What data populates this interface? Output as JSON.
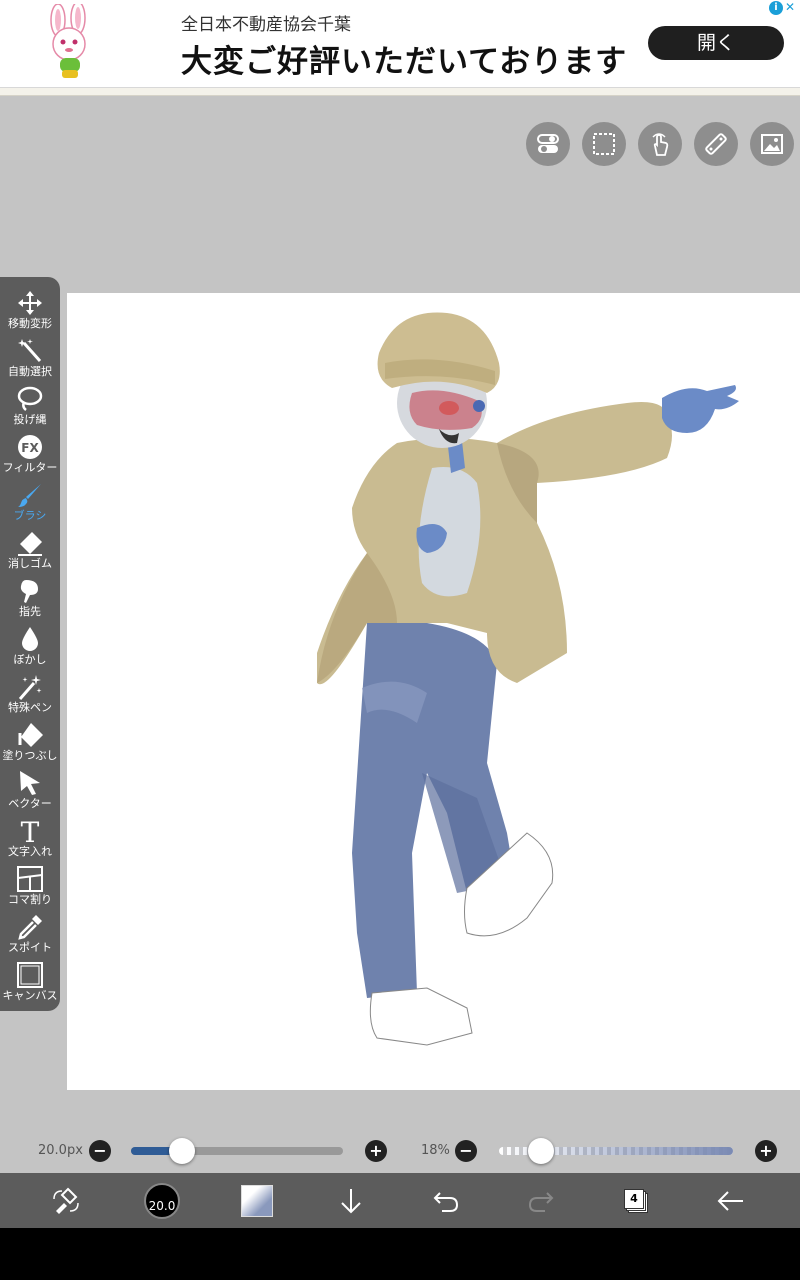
{
  "ad": {
    "org": "全日本不動産協会千葉",
    "headline": "大変ご好評いただいております",
    "button_label": "開く",
    "info_glyph": "i",
    "close_glyph": "✕"
  },
  "top_buttons": [
    "toggle-icon",
    "selection-icon",
    "touch-icon",
    "ruler-icon",
    "image-icon"
  ],
  "toolbar": {
    "items": [
      {
        "label": "移動変形",
        "icon": "move-icon"
      },
      {
        "label": "自動選択",
        "icon": "magic-wand-icon"
      },
      {
        "label": "投げ縄",
        "icon": "lasso-icon"
      },
      {
        "label": "フィルター",
        "icon": "fx-icon",
        "glyph": "FX"
      },
      {
        "label": "ブラシ",
        "icon": "brush-icon",
        "active": true
      },
      {
        "label": "消しゴム",
        "icon": "eraser-icon"
      },
      {
        "label": "指先",
        "icon": "finger-icon"
      },
      {
        "label": "ぼかし",
        "icon": "blur-icon"
      },
      {
        "label": "特殊ペン",
        "icon": "special-pen-icon"
      },
      {
        "label": "塗りつぶし",
        "icon": "fill-icon"
      },
      {
        "label": "ベクター",
        "icon": "vector-icon"
      },
      {
        "label": "文字入れ",
        "icon": "text-icon",
        "glyph": "T"
      },
      {
        "label": "コマ割り",
        "icon": "frame-divider-icon"
      },
      {
        "label": "スポイト",
        "icon": "eyedropper-icon"
      },
      {
        "label": "キャンバス",
        "icon": "canvas-icon"
      }
    ],
    "active_color": "#4aa8f0"
  },
  "brush_size": {
    "label": "20.0px",
    "fraction": 0.24
  },
  "opacity": {
    "label": "18%",
    "fraction": 0.18
  },
  "bottom_bar": {
    "brush_size_value": "20.0",
    "layer_count": "4",
    "brush_color": "#8a99bd"
  }
}
